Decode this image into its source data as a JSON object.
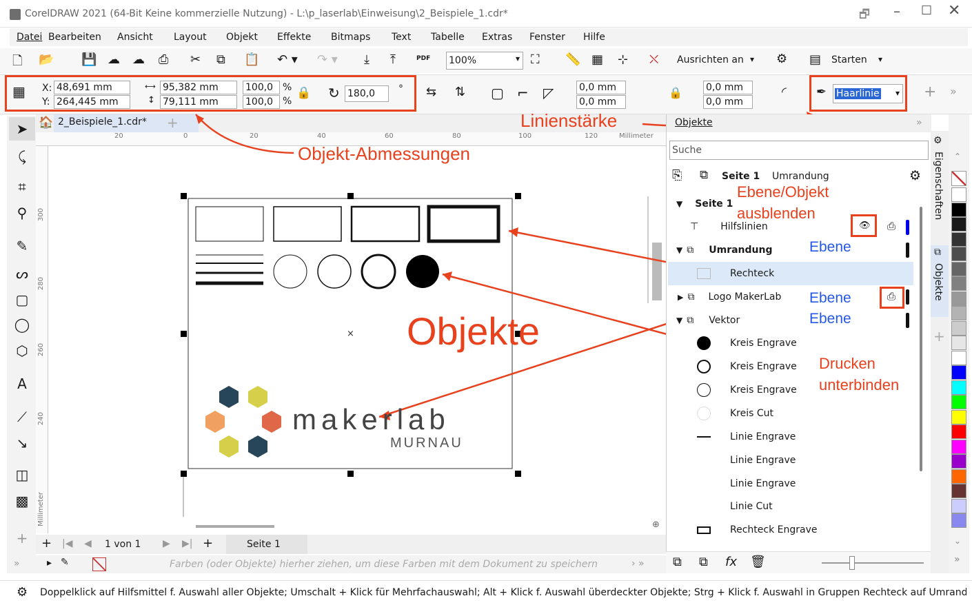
{
  "window": {
    "title": "CorelDRAW 2021 (64-Bit Keine kommerzielle Nutzung) - L:\\p_laserlab\\Einweisung\\2_Beispiele_1.cdr*"
  },
  "menu": [
    "Datei",
    "Bearbeiten",
    "Ansicht",
    "Layout",
    "Objekt",
    "Effekte",
    "Bitmaps",
    "Text",
    "Tabelle",
    "Extras",
    "Fenster",
    "Hilfe"
  ],
  "toolbar": {
    "zoom": "100%",
    "snap_label": "Ausrichten an",
    "start_label": "Starten",
    "pdf_label": "PDF"
  },
  "property_bar": {
    "x_label": "X:",
    "x_value": "48,691 mm",
    "y_label": "Y:",
    "y_value": "264,445 mm",
    "width_value": "95,382 mm",
    "height_value": "79,111 mm",
    "scale_w": "100,0",
    "scale_h": "100,0",
    "percent": "%",
    "rotation": "180,0",
    "degree": "°",
    "corner1": "0,0 mm",
    "corner2": "0,0 mm",
    "corner3": "0,0 mm",
    "corner4": "0,0 mm",
    "outline_width": "Haarlinie"
  },
  "document": {
    "tab": "2_Beispiele_1.cdr*",
    "ruler_unit": "Millimeter",
    "h_ruler": [
      "20",
      "0",
      "20",
      "40",
      "60",
      "80",
      "100",
      "120"
    ],
    "v_ruler": [
      "300",
      "280",
      "260",
      "240"
    ]
  },
  "page_nav": {
    "counter": "1 von 1",
    "page_tab": "Seite 1"
  },
  "palette_hint": "Farben (oder Objekte) hierher ziehen, um diese Farben mit dem Dokument zu speichern",
  "canvas": {
    "logo_main": "makerlab",
    "logo_sub": "MURNAU"
  },
  "objects_panel": {
    "title": "Objekte",
    "search_placeholder": "Suche",
    "page_label": "Seite 1",
    "layer_label": "Umrandung",
    "page_node": "Seite 1",
    "side_tabs": [
      "Eigenschaften",
      "Objekte"
    ],
    "items": [
      {
        "label": "Hilfslinien"
      },
      {
        "label": "Umrandung"
      },
      {
        "label": "Rechteck"
      },
      {
        "label": "Logo MakerLab"
      },
      {
        "label": "Vektor"
      },
      {
        "label": "Kreis Engrave"
      },
      {
        "label": "Kreis Engrave"
      },
      {
        "label": "Kreis Engrave"
      },
      {
        "label": "Kreis Cut"
      },
      {
        "label": "Linie Engrave"
      },
      {
        "label": "Linie Engrave"
      },
      {
        "label": "Linie Engrave"
      },
      {
        "label": "Linie Cut"
      },
      {
        "label": "Rechteck Engrave"
      }
    ]
  },
  "annotations": {
    "dimensions": "Objekt-Abmessungen",
    "line_width": "Linienstärke",
    "hide_line1": "Ebene/Objekt",
    "hide_line2": "ausblenden",
    "objects": "Objekte",
    "layer1": "Ebene",
    "layer2": "Ebene",
    "layer3": "Ebene",
    "print_line1": "Drucken",
    "print_line2": "unterbinden"
  },
  "status": {
    "hint": "Doppelklick auf Hilfsmittel f. Auswahl aller Objekte; Umschalt + Klick für Mehrfachauswahl; Alt + Klick f. Auswahl überdeckter Objekte; Strg + Klick f. Auswahl in Gruppen",
    "selection": "Rechteck auf Umrand"
  },
  "colors": {
    "annotation_red": "#e8411e",
    "annotation_blue": "#2458e6",
    "selection_blue": "#2a66d4"
  },
  "palette": [
    "#ffffff",
    "#000000",
    "#1a1a1a",
    "#333333",
    "#4d4d4d",
    "#666666",
    "#808080",
    "#999999",
    "#b3b3b3",
    "#cccccc",
    "#e6e6e6",
    "#ffffff",
    "#0000ff",
    "#00ffff",
    "#00ff00",
    "#ffff00",
    "#ff0000",
    "#ff00ff",
    "#9900cc",
    "#ff6600",
    "#663333",
    "#ccccff",
    "#8888ee"
  ]
}
